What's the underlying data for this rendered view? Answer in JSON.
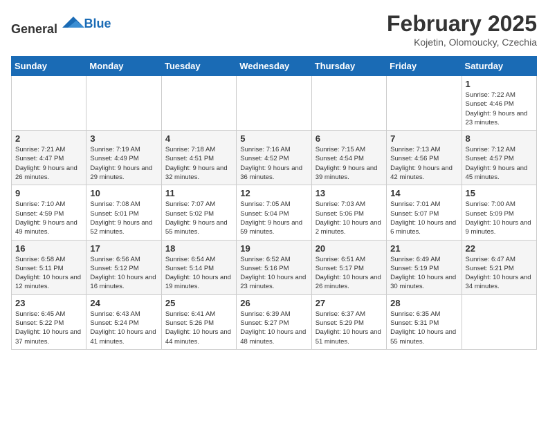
{
  "header": {
    "logo_general": "General",
    "logo_blue": "Blue",
    "month_year": "February 2025",
    "subtitle": "Kojetin, Olomoucky, Czechia"
  },
  "weekdays": [
    "Sunday",
    "Monday",
    "Tuesday",
    "Wednesday",
    "Thursday",
    "Friday",
    "Saturday"
  ],
  "weeks": [
    [
      null,
      null,
      null,
      null,
      null,
      null,
      {
        "day": "1",
        "sunrise": "7:22 AM",
        "sunset": "4:46 PM",
        "daylight": "9 hours and 23 minutes."
      }
    ],
    [
      {
        "day": "2",
        "sunrise": "7:21 AM",
        "sunset": "4:47 PM",
        "daylight": "9 hours and 26 minutes."
      },
      {
        "day": "3",
        "sunrise": "7:19 AM",
        "sunset": "4:49 PM",
        "daylight": "9 hours and 29 minutes."
      },
      {
        "day": "4",
        "sunrise": "7:18 AM",
        "sunset": "4:51 PM",
        "daylight": "9 hours and 32 minutes."
      },
      {
        "day": "5",
        "sunrise": "7:16 AM",
        "sunset": "4:52 PM",
        "daylight": "9 hours and 36 minutes."
      },
      {
        "day": "6",
        "sunrise": "7:15 AM",
        "sunset": "4:54 PM",
        "daylight": "9 hours and 39 minutes."
      },
      {
        "day": "7",
        "sunrise": "7:13 AM",
        "sunset": "4:56 PM",
        "daylight": "9 hours and 42 minutes."
      },
      {
        "day": "8",
        "sunrise": "7:12 AM",
        "sunset": "4:57 PM",
        "daylight": "9 hours and 45 minutes."
      }
    ],
    [
      {
        "day": "9",
        "sunrise": "7:10 AM",
        "sunset": "4:59 PM",
        "daylight": "9 hours and 49 minutes."
      },
      {
        "day": "10",
        "sunrise": "7:08 AM",
        "sunset": "5:01 PM",
        "daylight": "9 hours and 52 minutes."
      },
      {
        "day": "11",
        "sunrise": "7:07 AM",
        "sunset": "5:02 PM",
        "daylight": "9 hours and 55 minutes."
      },
      {
        "day": "12",
        "sunrise": "7:05 AM",
        "sunset": "5:04 PM",
        "daylight": "9 hours and 59 minutes."
      },
      {
        "day": "13",
        "sunrise": "7:03 AM",
        "sunset": "5:06 PM",
        "daylight": "10 hours and 2 minutes."
      },
      {
        "day": "14",
        "sunrise": "7:01 AM",
        "sunset": "5:07 PM",
        "daylight": "10 hours and 6 minutes."
      },
      {
        "day": "15",
        "sunrise": "7:00 AM",
        "sunset": "5:09 PM",
        "daylight": "10 hours and 9 minutes."
      }
    ],
    [
      {
        "day": "16",
        "sunrise": "6:58 AM",
        "sunset": "5:11 PM",
        "daylight": "10 hours and 12 minutes."
      },
      {
        "day": "17",
        "sunrise": "6:56 AM",
        "sunset": "5:12 PM",
        "daylight": "10 hours and 16 minutes."
      },
      {
        "day": "18",
        "sunrise": "6:54 AM",
        "sunset": "5:14 PM",
        "daylight": "10 hours and 19 minutes."
      },
      {
        "day": "19",
        "sunrise": "6:52 AM",
        "sunset": "5:16 PM",
        "daylight": "10 hours and 23 minutes."
      },
      {
        "day": "20",
        "sunrise": "6:51 AM",
        "sunset": "5:17 PM",
        "daylight": "10 hours and 26 minutes."
      },
      {
        "day": "21",
        "sunrise": "6:49 AM",
        "sunset": "5:19 PM",
        "daylight": "10 hours and 30 minutes."
      },
      {
        "day": "22",
        "sunrise": "6:47 AM",
        "sunset": "5:21 PM",
        "daylight": "10 hours and 34 minutes."
      }
    ],
    [
      {
        "day": "23",
        "sunrise": "6:45 AM",
        "sunset": "5:22 PM",
        "daylight": "10 hours and 37 minutes."
      },
      {
        "day": "24",
        "sunrise": "6:43 AM",
        "sunset": "5:24 PM",
        "daylight": "10 hours and 41 minutes."
      },
      {
        "day": "25",
        "sunrise": "6:41 AM",
        "sunset": "5:26 PM",
        "daylight": "10 hours and 44 minutes."
      },
      {
        "day": "26",
        "sunrise": "6:39 AM",
        "sunset": "5:27 PM",
        "daylight": "10 hours and 48 minutes."
      },
      {
        "day": "27",
        "sunrise": "6:37 AM",
        "sunset": "5:29 PM",
        "daylight": "10 hours and 51 minutes."
      },
      {
        "day": "28",
        "sunrise": "6:35 AM",
        "sunset": "5:31 PM",
        "daylight": "10 hours and 55 minutes."
      },
      null
    ]
  ]
}
